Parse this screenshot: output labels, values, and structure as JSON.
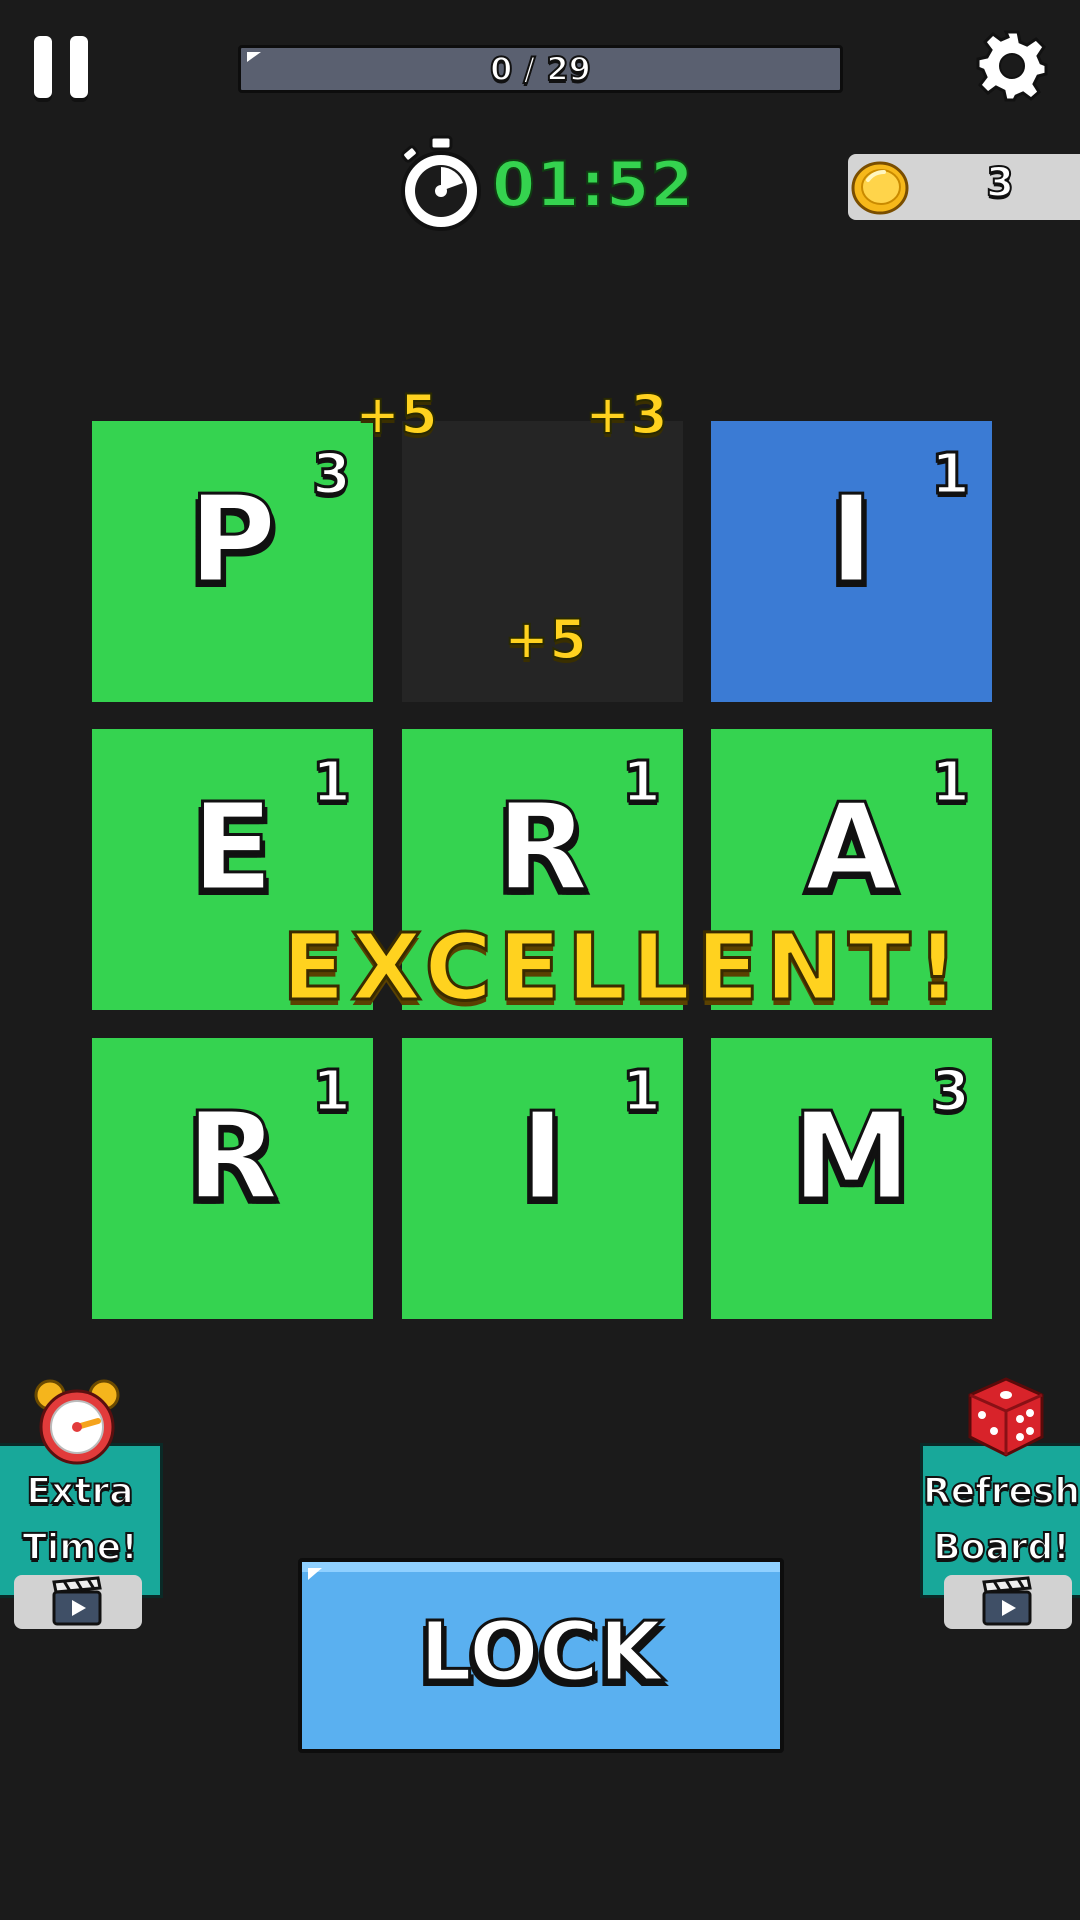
{
  "hud": {
    "progress_text": "0 / 29",
    "progress_fraction": 0,
    "timer": "01:52",
    "coins": "3"
  },
  "grid": {
    "tiles": [
      {
        "letter": "P",
        "score": "3",
        "state": "green"
      },
      {
        "letter": "",
        "score": "",
        "state": "empty"
      },
      {
        "letter": "I",
        "score": "1",
        "state": "blue"
      },
      {
        "letter": "E",
        "score": "1",
        "state": "green"
      },
      {
        "letter": "R",
        "score": "1",
        "state": "green"
      },
      {
        "letter": "A",
        "score": "1",
        "state": "green"
      },
      {
        "letter": "R",
        "score": "1",
        "state": "green"
      },
      {
        "letter": "I",
        "score": "1",
        "state": "green"
      },
      {
        "letter": "M",
        "score": "3",
        "state": "green"
      }
    ],
    "bonus_popups": [
      "+5",
      "+3",
      "+5"
    ]
  },
  "feedback": "EXCELLENT!",
  "powerups": {
    "extra_time": {
      "line1": "Extra",
      "line2": "Time!",
      "icon": "alarm-clock-icon"
    },
    "refresh_board": {
      "line1": "Refresh",
      "line2": "Board!",
      "icon": "dice-icon"
    }
  },
  "lock_label": "LOCK",
  "colors": {
    "background": "#1b1b1b",
    "tile_green": "#35d350",
    "tile_blue": "#3b7bd4",
    "tile_empty": "#252525",
    "timer_green": "#35d34f",
    "accent_yellow": "#ffd21f",
    "lock_blue": "#5ab0f0",
    "powerup_teal": "#18a89a"
  }
}
